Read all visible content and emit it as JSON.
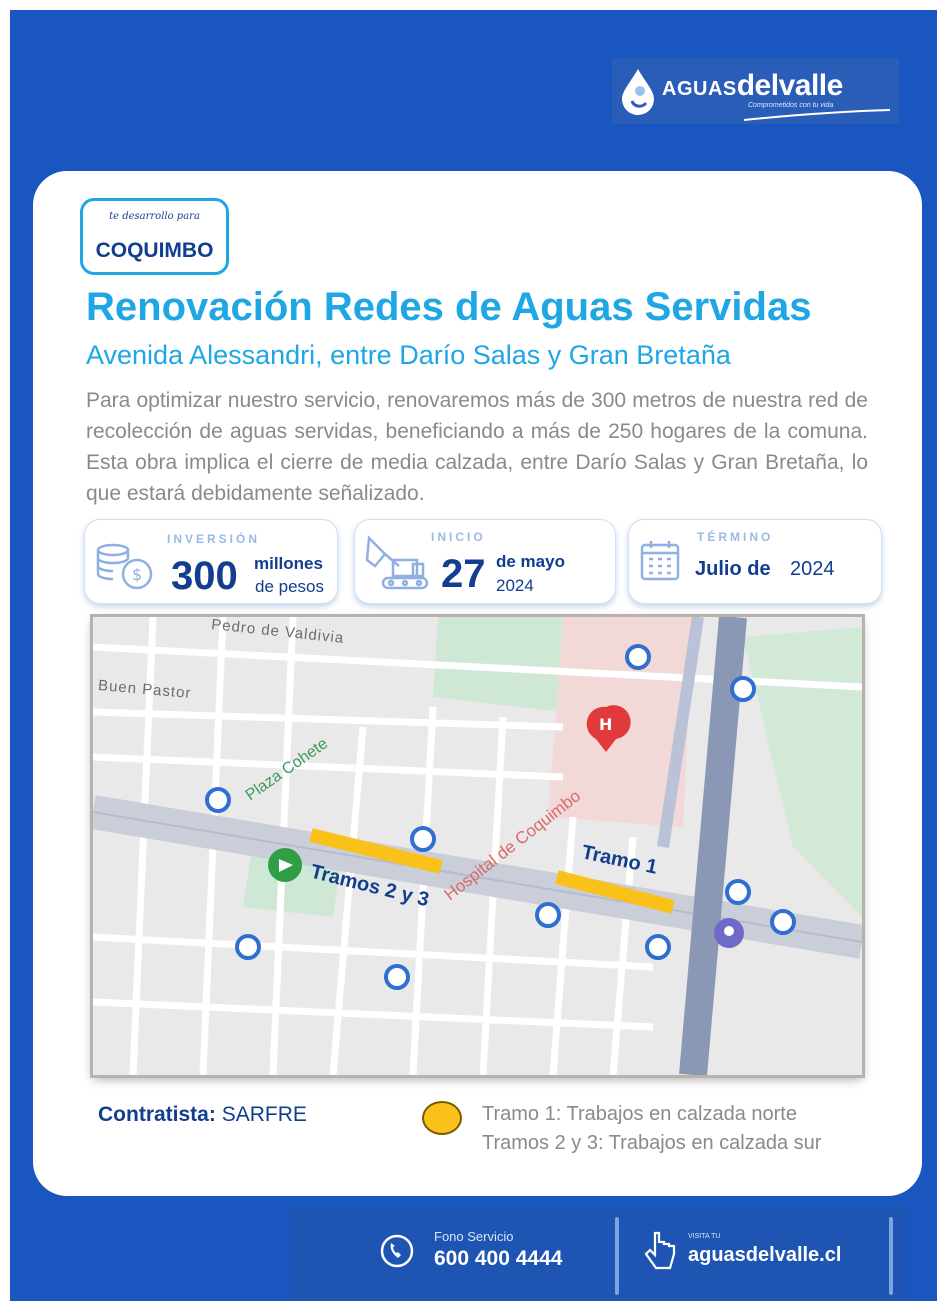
{
  "brand": {
    "name_prefix": "AGUAS",
    "name_main": "delvalle",
    "tagline": "Comprometidos con tu vida"
  },
  "badge": {
    "script": "te desarrollo para",
    "city": "COQUIMBO"
  },
  "title": "Renovación Redes de Aguas Servidas",
  "subtitle": "Avenida Alessandri, entre Darío Salas y Gran Bretaña",
  "description": "Para optimizar nuestro servicio, renovaremos más de 300 metros de nuestra red de recolección de aguas servidas, beneficiando a más de 250 hogares de la comuna. Esta obra implica el cierre de media calzada, entre Darío Salas y Gran Bretaña, lo que estará debidamente señalizado.",
  "stats": {
    "inversion": {
      "label": "INVERSIÓN",
      "value": "300",
      "unit_bold": "millones",
      "unit": "de pesos",
      "icon": "coins-icon"
    },
    "inicio": {
      "label": "INICIO",
      "value": "27",
      "unit_bold": "de mayo",
      "unit": "2024",
      "icon": "excavator-icon"
    },
    "termino": {
      "label": "TÉRMINO",
      "value_bold": "Julio de",
      "value": "2024",
      "icon": "calendar-icon"
    }
  },
  "map": {
    "streets": [
      "Pedro de Valdivia",
      "Buen Pastor",
      "Plaza Cohete",
      "Hospital de Coquimbo"
    ],
    "segments": [
      "Tramo 1",
      "Tramos 2 y 3"
    ],
    "colors": {
      "segment": "#f9c11a",
      "label": "#133d8f",
      "pin_blue": "#2f6fd1",
      "pin_red": "#e03a3a",
      "pin_green": "#2f9e44"
    }
  },
  "contractor": {
    "label": "Contratista:",
    "value": "SARFRE"
  },
  "legend": {
    "line1": "Tramo 1: Trabajos en calzada norte",
    "line2": "Tramos 2 y 3: Trabajos en calzada sur",
    "color": "#f9c11a"
  },
  "footer": {
    "phone_label": "Fono Servicio",
    "phone": "600 400 4444",
    "web_label": "VISITA TU",
    "web": "aguasdelvalle.cl"
  }
}
